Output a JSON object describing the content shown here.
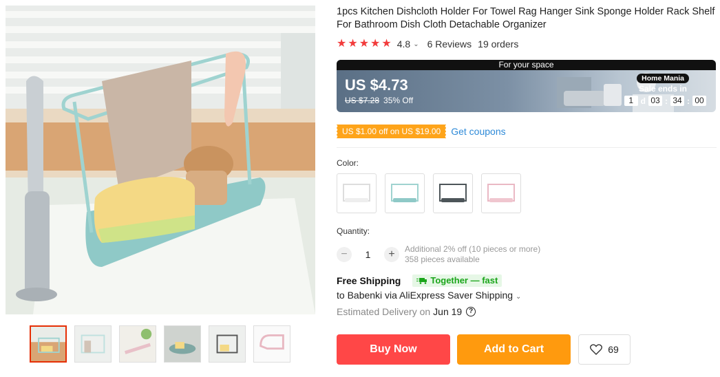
{
  "product": {
    "title": "1pcs Kitchen Dishcloth Holder For Towel Rag Hanger Sink Sponge Holder Rack Shelf For Bathroom Dish Cloth Detachable Organizer",
    "rating": "4.8",
    "rating_stars": 5,
    "reviews": "6 Reviews",
    "orders": "19 orders"
  },
  "banner": {
    "top_text": "For your space",
    "price": "US $4.73",
    "original_price": "US $7.28",
    "discount": "35% Off",
    "store_badge": "Home Mania",
    "sale_ends_label": "Sale ends in",
    "countdown": {
      "days": "1",
      "days_unit": "d",
      "hours": "03",
      "minutes": "34",
      "seconds": "00"
    }
  },
  "coupon": {
    "text": "US $1.00 off on US $19.00",
    "link": "Get coupons"
  },
  "color": {
    "label": "Color:",
    "options": [
      "white",
      "light-blue",
      "dark-gray",
      "pink"
    ]
  },
  "quantity": {
    "label": "Quantity:",
    "value": "1",
    "minus": "−",
    "plus": "+",
    "note_line1": "Additional 2% off (10 pieces or more)",
    "note_line2": "358 pieces available"
  },
  "shipping": {
    "free": "Free Shipping",
    "badge": "Together — fast",
    "via": "to Babenki via AliExpress Saver Shipping",
    "delivery_label": "Estimated Delivery on",
    "delivery_date": "Jun 19"
  },
  "actions": {
    "buy": "Buy Now",
    "cart": "Add to Cart",
    "wishlist_count": "69"
  },
  "colors": {
    "star": "#f23c3c",
    "buy": "#ff4747",
    "cart": "#ff9a0e",
    "coupon": "#fea41a",
    "link": "#2e8ad8",
    "together": "#1aa51a"
  }
}
